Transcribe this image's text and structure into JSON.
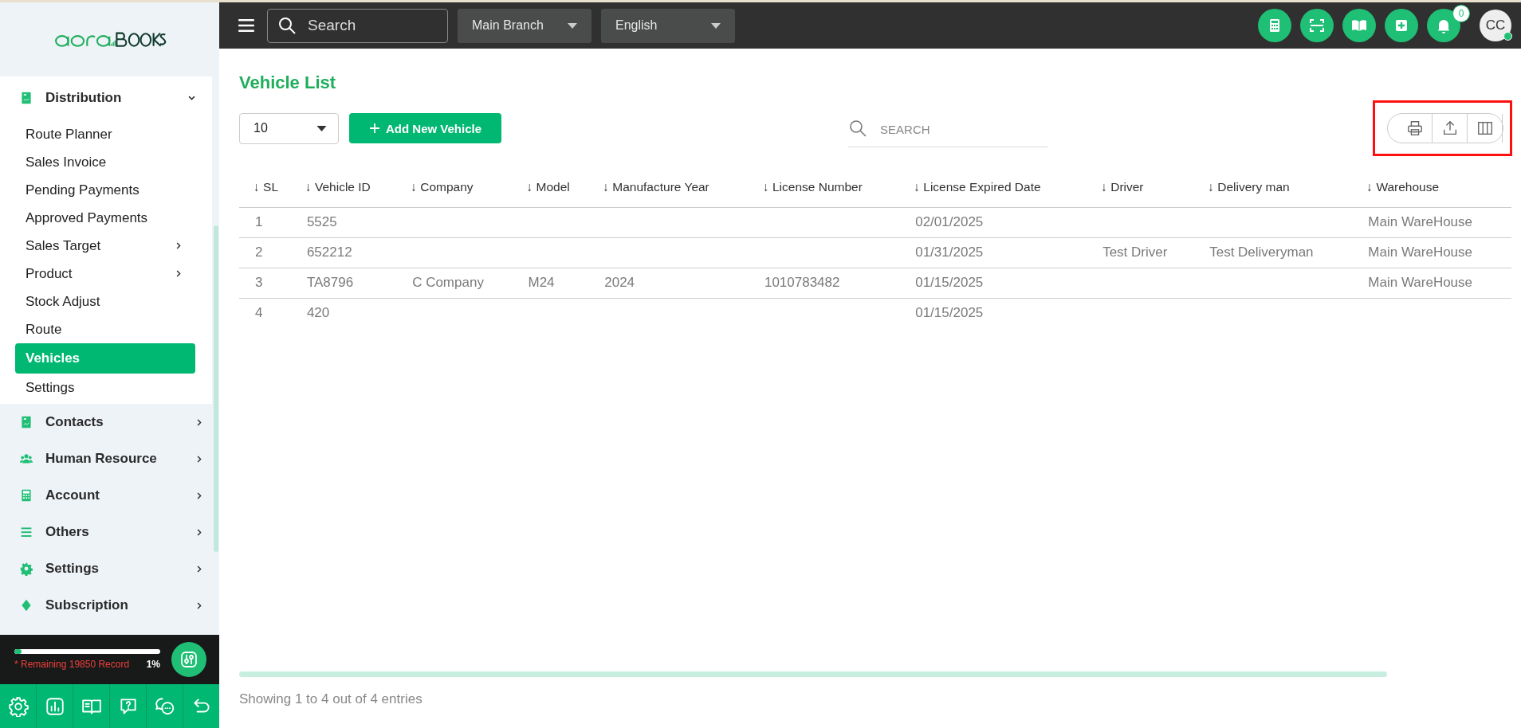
{
  "sidebar": {
    "menu": [
      {
        "label": "Distribution",
        "expanded": true,
        "children": [
          {
            "label": "Route Planner",
            "kind": "link",
            "selected": false
          },
          {
            "label": "Sales Invoice",
            "kind": "link",
            "selected": false
          },
          {
            "label": "Pending Payments",
            "kind": "link",
            "selected": false
          },
          {
            "label": "Approved Payments",
            "kind": "link",
            "selected": false
          },
          {
            "label": "Sales Target",
            "kind": "submenu",
            "selected": false
          },
          {
            "label": "Product",
            "kind": "submenu",
            "selected": false
          },
          {
            "label": "Stock Adjust",
            "kind": "link",
            "selected": false
          },
          {
            "label": "Route",
            "kind": "link",
            "selected": false
          },
          {
            "label": "Vehicles",
            "kind": "link",
            "selected": true
          },
          {
            "label": "Settings",
            "kind": "link",
            "selected": false
          }
        ]
      },
      {
        "label": "Contacts",
        "expanded": false
      },
      {
        "label": "Human Resource",
        "expanded": false
      },
      {
        "label": "Account",
        "expanded": false
      },
      {
        "label": "Others",
        "expanded": false
      },
      {
        "label": "Settings",
        "expanded": false
      },
      {
        "label": "Subscription",
        "expanded": false
      }
    ],
    "usage": {
      "level": 0.01,
      "note": "* Remaining 19850 Record",
      "percent": "1%"
    }
  },
  "topbar": {
    "search": {
      "placeholder": "Search"
    },
    "branch": "Main Branch",
    "language": "English",
    "notifications": "0",
    "avatar": "CC",
    "online": true
  },
  "page": {
    "title": "Vehicle List",
    "page_size": "10",
    "add_button": "Add New Vehicle",
    "search": {
      "placeholder": "SEARCH"
    },
    "toolbar_highlighted": true
  },
  "table": {
    "columns": [
      "↓ SL",
      "↓ Vehicle ID",
      "↓ Company",
      "↓ Model",
      "↓ Manufacture Year",
      "↓ License Number",
      "↓ License Expired Date",
      "↓ Driver",
      "↓ Delivery man",
      "↓ Warehouse"
    ],
    "rows": [
      [
        "1",
        "5525",
        null,
        null,
        null,
        null,
        "02/01/2025",
        null,
        null,
        "Main WareHouse"
      ],
      [
        "2",
        "652212",
        null,
        null,
        null,
        null,
        "01/31/2025",
        "Test Driver",
        "Test Deliveryman",
        "Main WareHouse"
      ],
      [
        "3",
        "TA8796",
        "C Company",
        "M24",
        "2024",
        "1010783482",
        "01/15/2025",
        null,
        null,
        "Main WareHouse"
      ],
      [
        "4",
        "420",
        null,
        null,
        null,
        null,
        "01/15/2025",
        null,
        null,
        null
      ]
    ]
  },
  "footer": "Showing 1 to 4 out of 4 entries"
}
